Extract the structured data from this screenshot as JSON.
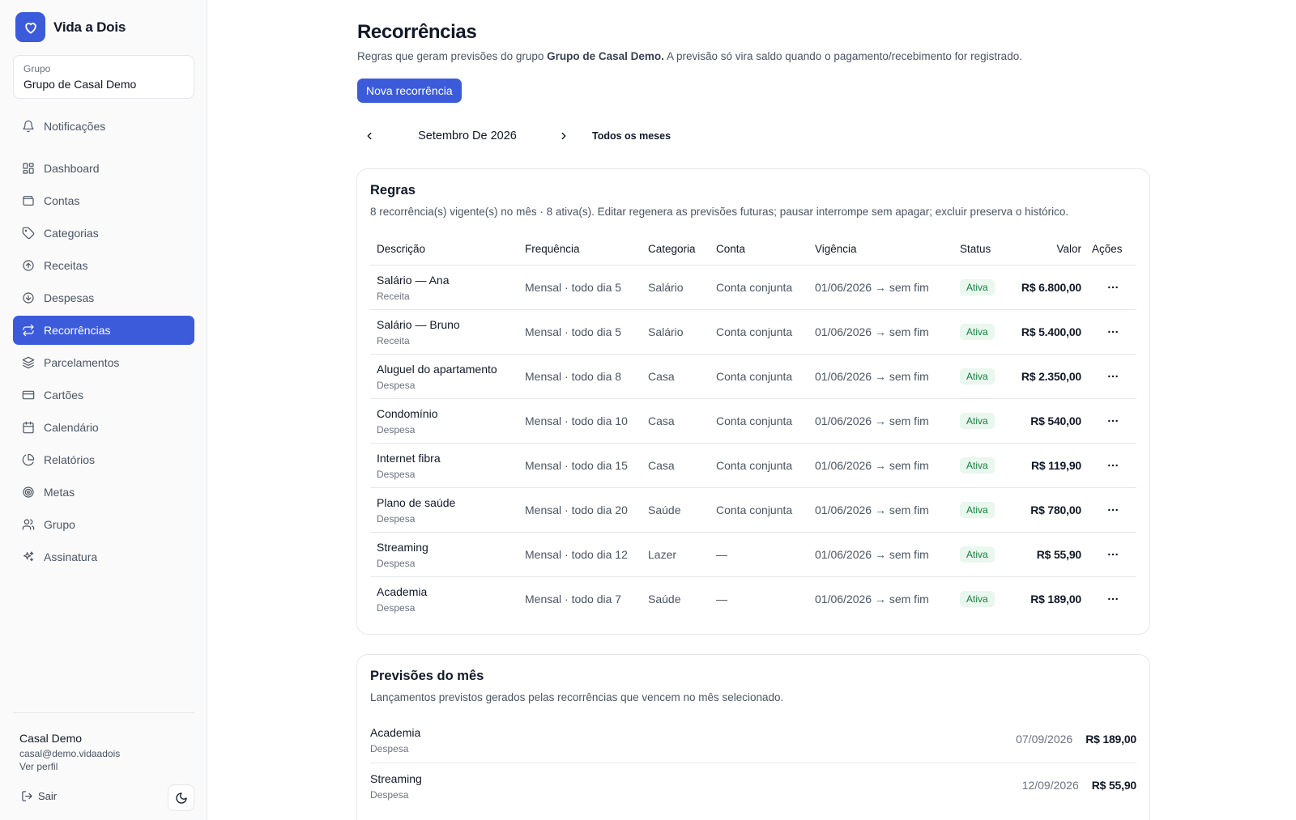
{
  "app": {
    "name": "Vida a Dois"
  },
  "group": {
    "label": "Grupo",
    "name": "Grupo de Casal Demo"
  },
  "nav": {
    "notifications": "Notificações",
    "items": [
      {
        "label": "Dashboard",
        "icon": "dashboard-icon"
      },
      {
        "label": "Contas",
        "icon": "wallet-icon"
      },
      {
        "label": "Categorias",
        "icon": "tag-icon"
      },
      {
        "label": "Receitas",
        "icon": "arrow-up-circle-icon"
      },
      {
        "label": "Despesas",
        "icon": "arrow-down-circle-icon"
      },
      {
        "label": "Recorrências",
        "icon": "repeat-icon",
        "active": true
      },
      {
        "label": "Parcelamentos",
        "icon": "layers-icon"
      },
      {
        "label": "Cartões",
        "icon": "credit-card-icon"
      },
      {
        "label": "Calendário",
        "icon": "calendar-icon"
      },
      {
        "label": "Relatórios",
        "icon": "pie-chart-icon"
      },
      {
        "label": "Metas",
        "icon": "target-icon"
      },
      {
        "label": "Grupo",
        "icon": "users-icon"
      },
      {
        "label": "Assinatura",
        "icon": "sparkles-icon"
      }
    ]
  },
  "user": {
    "name": "Casal Demo",
    "email": "casal@demo.vidaadois",
    "profile_link": "Ver perfil",
    "logout": "Sair"
  },
  "header": {
    "title": "Recorrências",
    "desc_prefix": "Regras que geram previsões do grupo ",
    "desc_group": "Grupo de Casal Demo.",
    "desc_suffix": " A previsão só vira saldo quando o pagamento/recebimento for registrado.",
    "new_button": "Nova recorrência"
  },
  "month_nav": {
    "label": "Setembro De 2026",
    "all_months": "Todos os meses"
  },
  "rules": {
    "title": "Regras",
    "subtitle": "8 recorrência(s) vigente(s) no mês · 8 ativa(s). Editar regenera as previsões futuras; pausar interrompe sem apagar; excluir preserva o histórico.",
    "columns": {
      "desc": "Descrição",
      "freq": "Frequência",
      "cat": "Categoria",
      "acc": "Conta",
      "vig": "Vigência",
      "status": "Status",
      "value": "Valor",
      "actions": "Ações"
    },
    "rows": [
      {
        "desc": "Salário — Ana",
        "type": "Receita",
        "freq": "Mensal · todo dia 5",
        "cat": "Salário",
        "acc": "Conta conjunta",
        "vig": "01/06/2026 → sem fim",
        "status": "Ativa",
        "value": "R$ 6.800,00"
      },
      {
        "desc": "Salário — Bruno",
        "type": "Receita",
        "freq": "Mensal · todo dia 5",
        "cat": "Salário",
        "acc": "Conta conjunta",
        "vig": "01/06/2026 → sem fim",
        "status": "Ativa",
        "value": "R$ 5.400,00"
      },
      {
        "desc": "Aluguel do apartamento",
        "type": "Despesa",
        "freq": "Mensal · todo dia 8",
        "cat": "Casa",
        "acc": "Conta conjunta",
        "vig": "01/06/2026 → sem fim",
        "status": "Ativa",
        "value": "R$ 2.350,00"
      },
      {
        "desc": "Condomínio",
        "type": "Despesa",
        "freq": "Mensal · todo dia 10",
        "cat": "Casa",
        "acc": "Conta conjunta",
        "vig": "01/06/2026 → sem fim",
        "status": "Ativa",
        "value": "R$ 540,00"
      },
      {
        "desc": "Internet fibra",
        "type": "Despesa",
        "freq": "Mensal · todo dia 15",
        "cat": "Casa",
        "acc": "Conta conjunta",
        "vig": "01/06/2026 → sem fim",
        "status": "Ativa",
        "value": "R$ 119,90"
      },
      {
        "desc": "Plano de saúde",
        "type": "Despesa",
        "freq": "Mensal · todo dia 20",
        "cat": "Saúde",
        "acc": "Conta conjunta",
        "vig": "01/06/2026 → sem fim",
        "status": "Ativa",
        "value": "R$ 780,00"
      },
      {
        "desc": "Streaming",
        "type": "Despesa",
        "freq": "Mensal · todo dia 12",
        "cat": "Lazer",
        "acc": "—",
        "vig": "01/06/2026 → sem fim",
        "status": "Ativa",
        "value": "R$ 55,90"
      },
      {
        "desc": "Academia",
        "type": "Despesa",
        "freq": "Mensal · todo dia 7",
        "cat": "Saúde",
        "acc": "—",
        "vig": "01/06/2026 → sem fim",
        "status": "Ativa",
        "value": "R$ 189,00"
      }
    ]
  },
  "forecast": {
    "title": "Previsões do mês",
    "subtitle": "Lançamentos previstos gerados pelas recorrências que vencem no mês selecionado.",
    "items": [
      {
        "desc": "Academia",
        "type": "Despesa",
        "date": "07/09/2026",
        "value": "R$ 189,00"
      },
      {
        "desc": "Streaming",
        "type": "Despesa",
        "date": "12/09/2026",
        "value": "R$ 55,90"
      }
    ]
  },
  "colors": {
    "accent": "#3b5bdb",
    "badge_bg": "#e9f7ee",
    "badge_text": "#15803d"
  }
}
